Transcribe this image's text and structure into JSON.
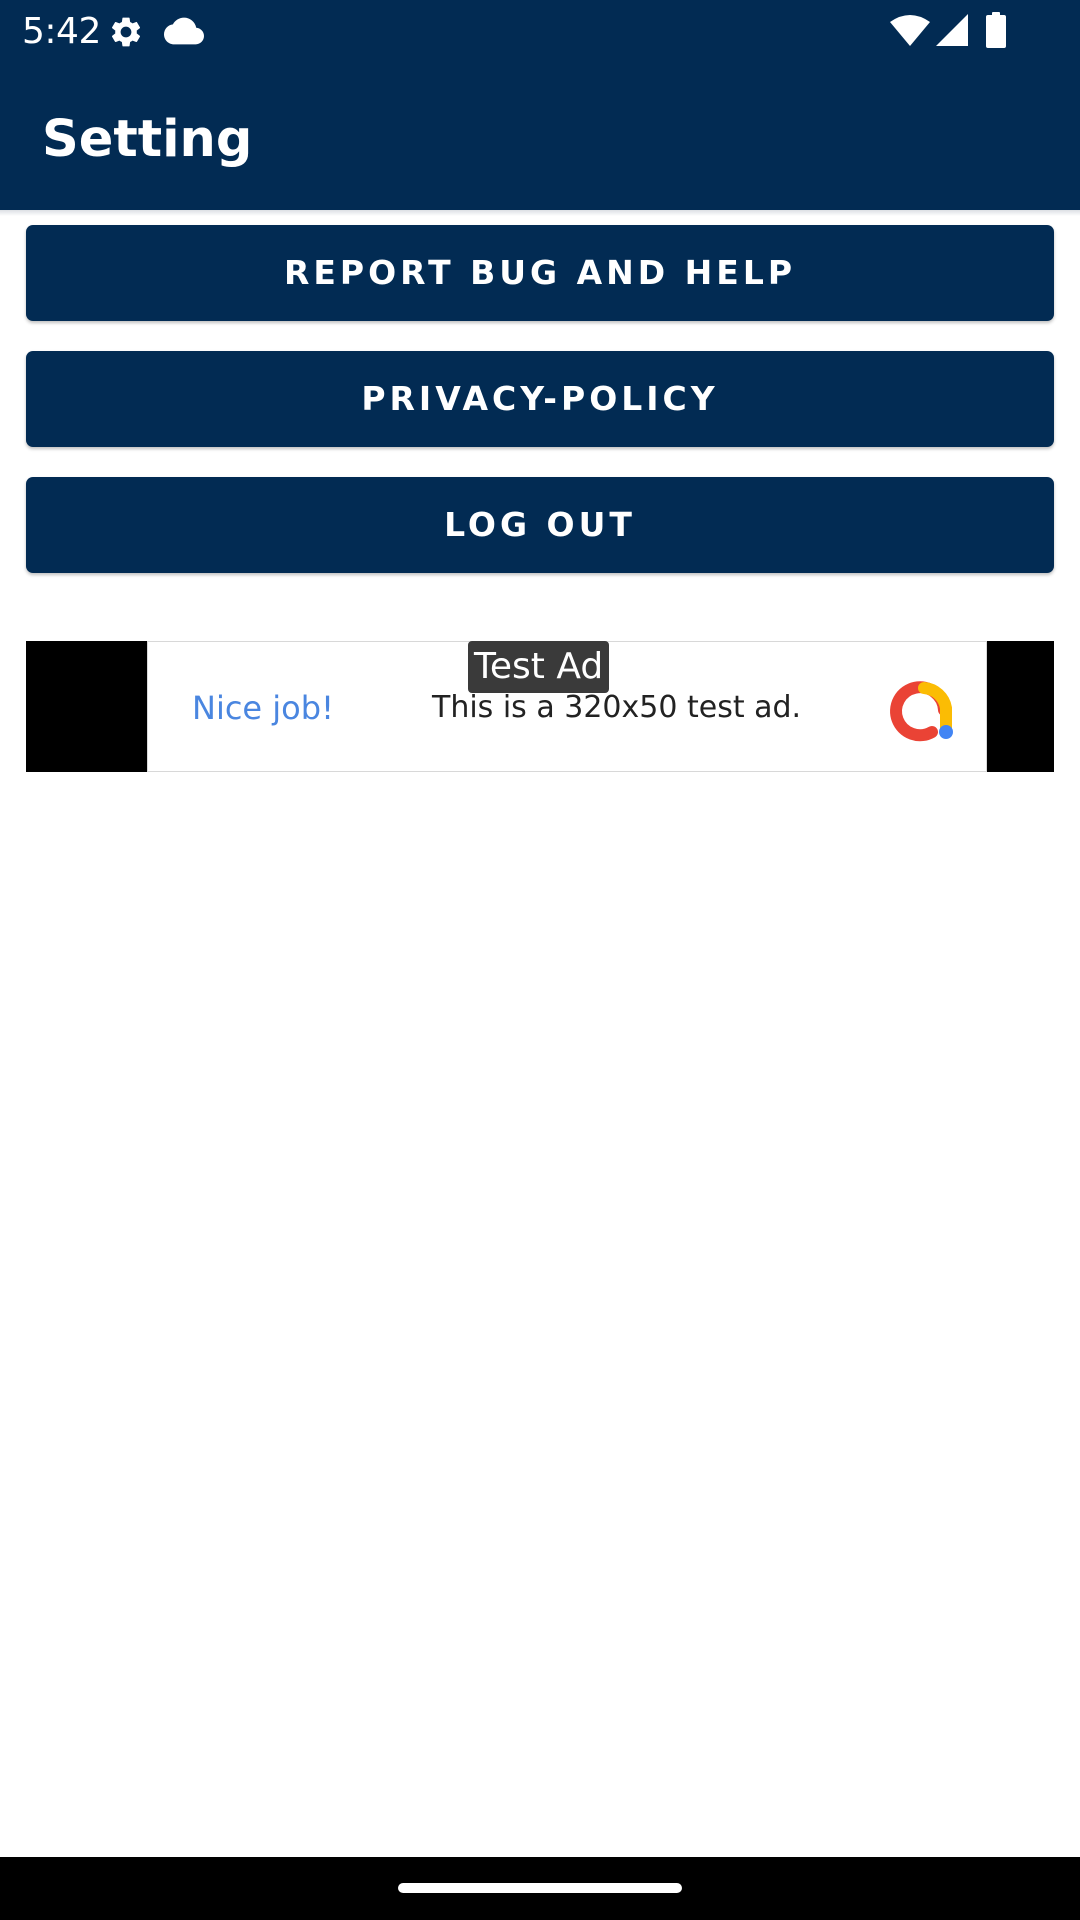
{
  "status_bar": {
    "time": "5:42",
    "icons": [
      "gear-icon",
      "cloud-icon",
      "wifi-icon",
      "cell-signal-icon",
      "battery-icon"
    ]
  },
  "app_bar": {
    "title": "Setting"
  },
  "buttons": {
    "report_bug": "REPORT BUG AND HELP",
    "privacy_policy": "PRIVACY-POLICY",
    "log_out": "LOG OUT"
  },
  "ad": {
    "label": "Test Ad",
    "headline": "Nice job!",
    "body": "This is a 320x50 test ad."
  },
  "colors": {
    "primary": "#022b53",
    "ad_headline": "#4a86e0",
    "logo_red": "#ea4335",
    "logo_yellow": "#fbbc04",
    "logo_blue": "#4285f4"
  }
}
